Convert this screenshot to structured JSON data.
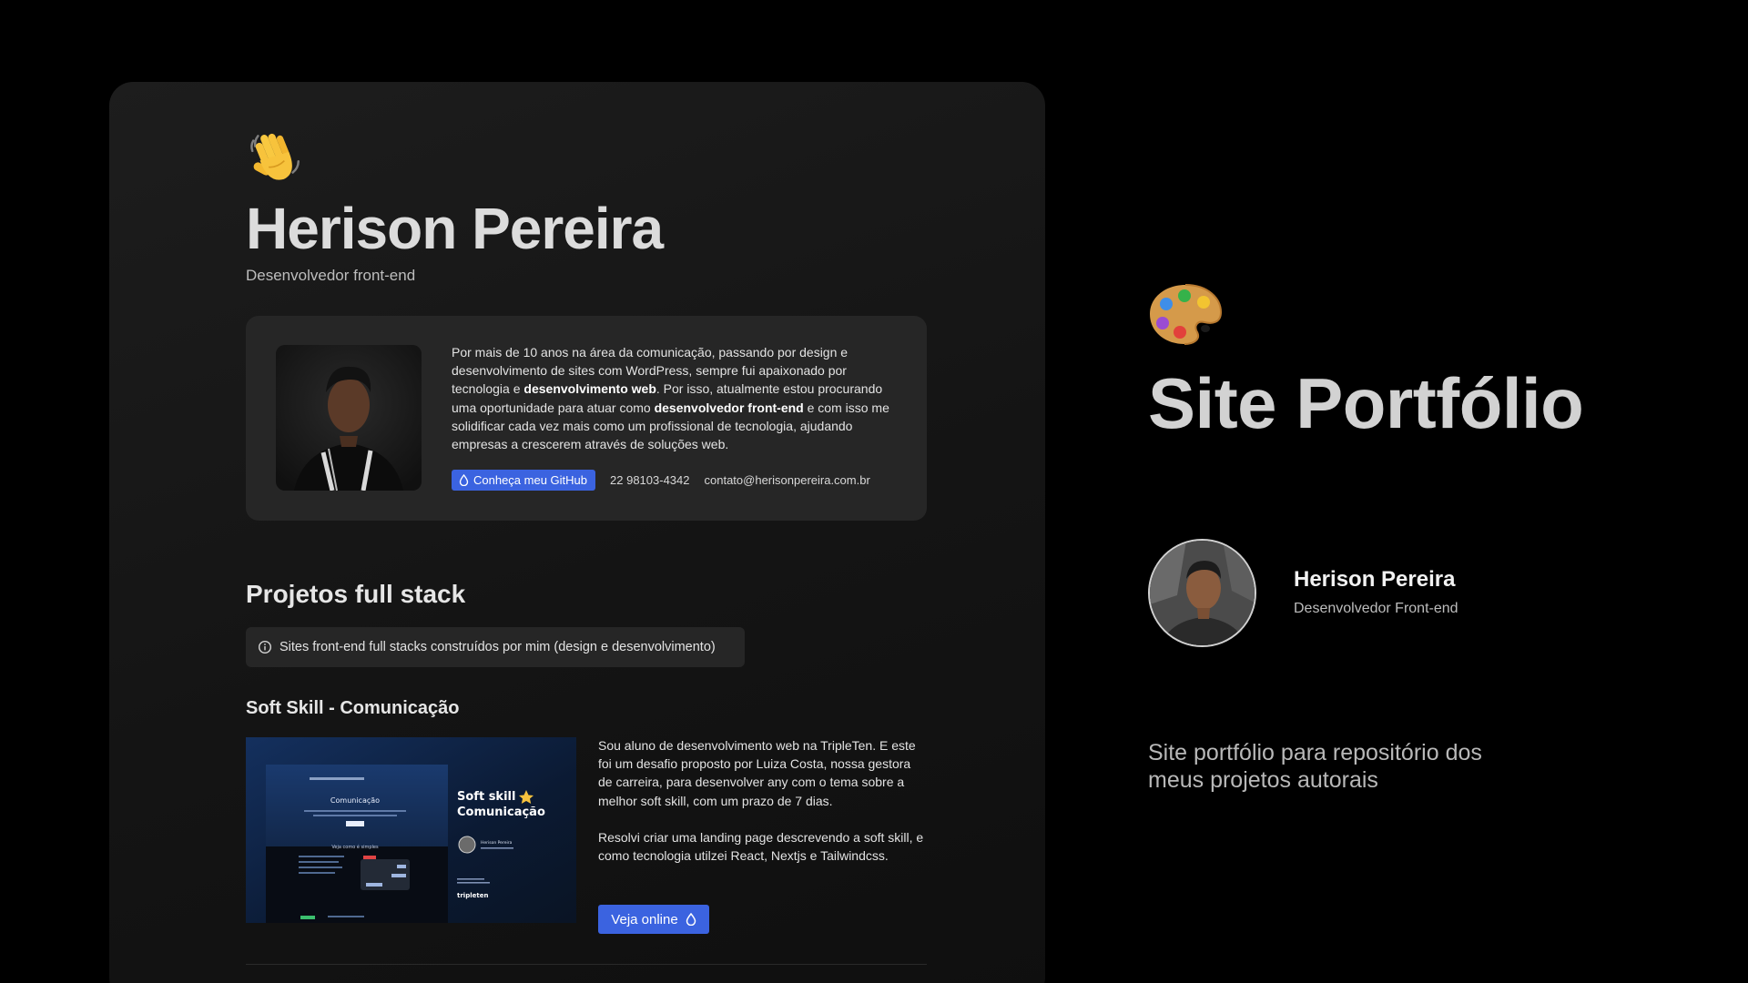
{
  "site": {
    "hero": {
      "name": "Herison Pereira",
      "role": "Desenvolvedor front-end"
    },
    "about": {
      "text_1": "Por mais de 10 anos na área da comunicação, passando por design e desenvolvimento de sites com WordPress, sempre fui apaixonado por tecnologia e ",
      "bold_1": "desenvolvimento web",
      "text_2": ". Por isso, atualmente estou procurando uma oportunidade para atuar como ",
      "bold_2": "desenvolvedor front-end",
      "text_3": " e com isso me solidificar cada vez mais como um profissional de tecnologia, ajudando empresas a crescerem através de soluções web.",
      "github_label": "Conheça meu GitHub",
      "phone": "22 98103-4342",
      "email": "contato@herisonpereira.com.br"
    },
    "projects_section": {
      "title": "Projetos full stack",
      "info": "Sites front-end full stacks construídos por mim (design e desenvolvimento)"
    },
    "project": {
      "title": "Soft Skill - Comunicação",
      "desc_1": "Sou aluno de desenvolvimento web na TripleTen. E este foi um desafio proposto por Luiza Costa, nossa gestora de carreira, para desenvolver any com o tema sobre a melhor soft skill, com um prazo de 7 dias.",
      "desc_2": "Resolvi criar uma landing page descrevendo a soft skill, e como tecnologia utilzei React, Nextjs e Tailwindcss.",
      "online_label": "Veja online",
      "thumb": {
        "heading_left": "Comunicação",
        "heading_right_1": "Soft skill",
        "heading_right_2": "Comunicação",
        "author": "Herison Pereira",
        "section_label": "Veja como é simples",
        "brand": "tripleten"
      }
    }
  },
  "panel": {
    "title": "Site Portfólio",
    "author_name": "Herison Pereira",
    "author_role": "Desenvolvedor Front-end",
    "description": "Site portfólio para repositório dos meus projetos autorais"
  },
  "icons": {
    "hero": "waving-hand-icon",
    "panel": "artist-palette-icon",
    "github": "drop-icon",
    "info": "info-circle-icon",
    "online": "drop-icon"
  },
  "colors": {
    "accent": "#3b63e0",
    "background": "#000000",
    "card": "#1a1a1a",
    "surface": "#262626"
  }
}
